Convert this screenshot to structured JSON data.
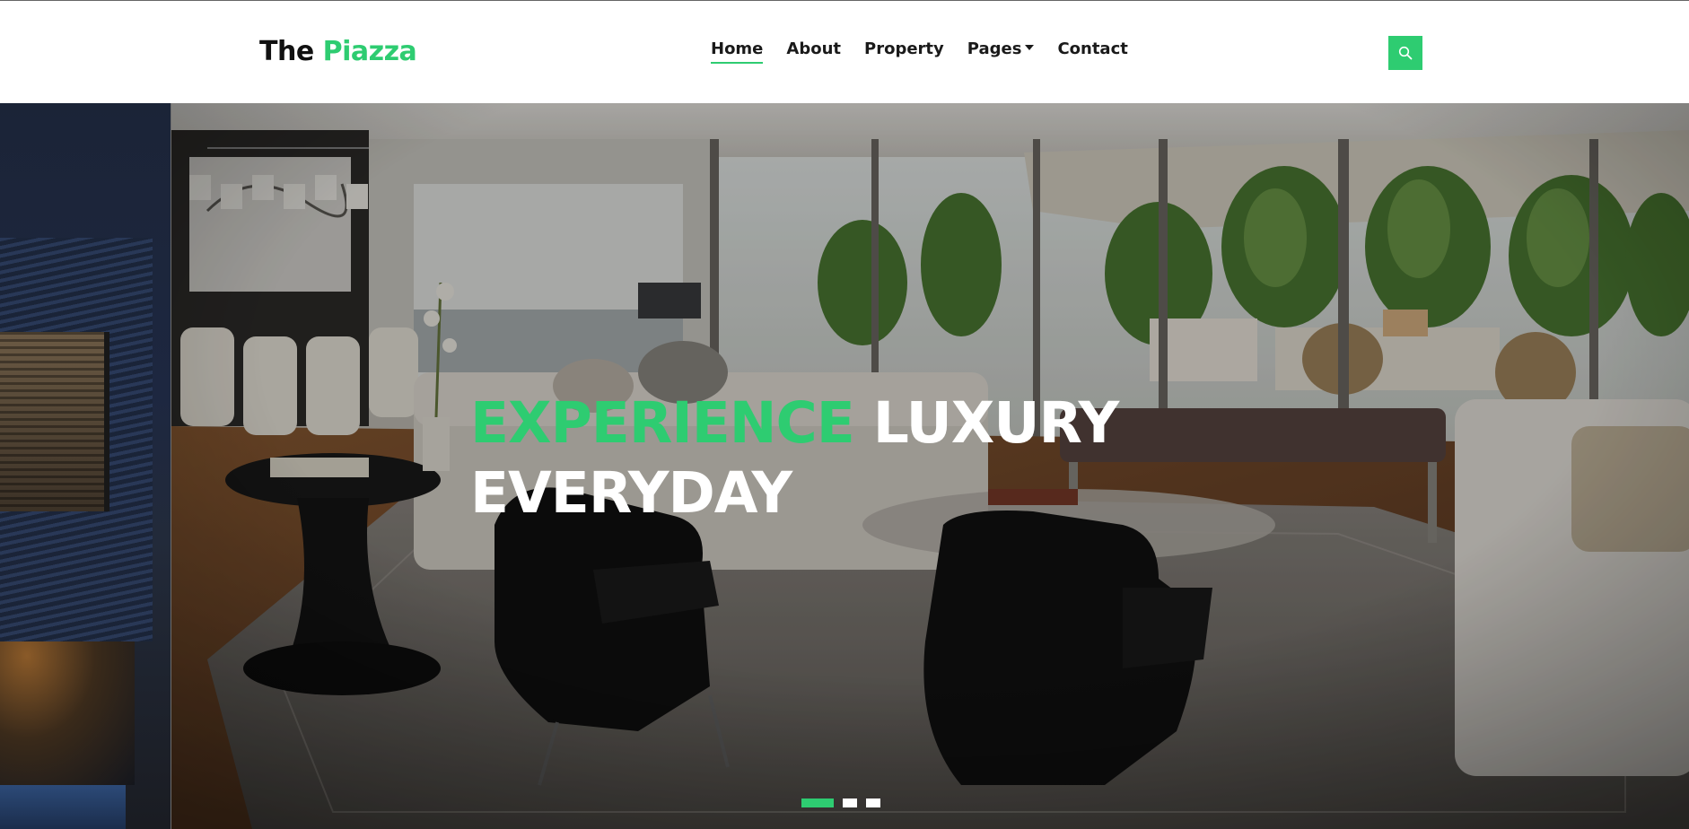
{
  "brand": {
    "part1": "The ",
    "part2": "Piazza",
    "accent_color": "#2ecc71"
  },
  "nav": {
    "items": [
      {
        "label": "Home",
        "active": true
      },
      {
        "label": "About",
        "active": false
      },
      {
        "label": "Property",
        "active": false
      },
      {
        "label": "Pages",
        "active": false,
        "has_dropdown": true
      },
      {
        "label": "Contact",
        "active": false
      }
    ]
  },
  "search": {
    "icon": "search-icon"
  },
  "hero": {
    "headline_accent": "EXPERIENCE",
    "headline_rest": " LUXURY",
    "headline_line2": "EVERYDAY",
    "slides_total": 3,
    "active_slide": 1
  }
}
